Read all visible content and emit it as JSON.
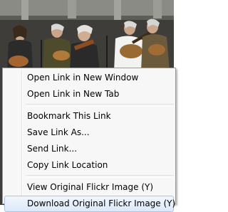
{
  "menu": {
    "open_new_window": "Open Link in New Window",
    "open_new_tab": "Open Link in New Tab",
    "bookmark_link": "Bookmark This Link",
    "save_link_as": "Save Link As...",
    "send_link": "Send Link...",
    "copy_link_location": "Copy Link Location",
    "view_original_flickr": "View Original Flickr Image (Y)",
    "download_original_flickr": "Download Original Flickr Image (Y)"
  },
  "colors": {
    "menu_background": "#f7f7f7",
    "menu_border": "#9a9a9a",
    "highlight_top": "#f1f6fc",
    "highlight_bottom": "#dce9f8",
    "highlight_border": "#a9c4e6"
  }
}
